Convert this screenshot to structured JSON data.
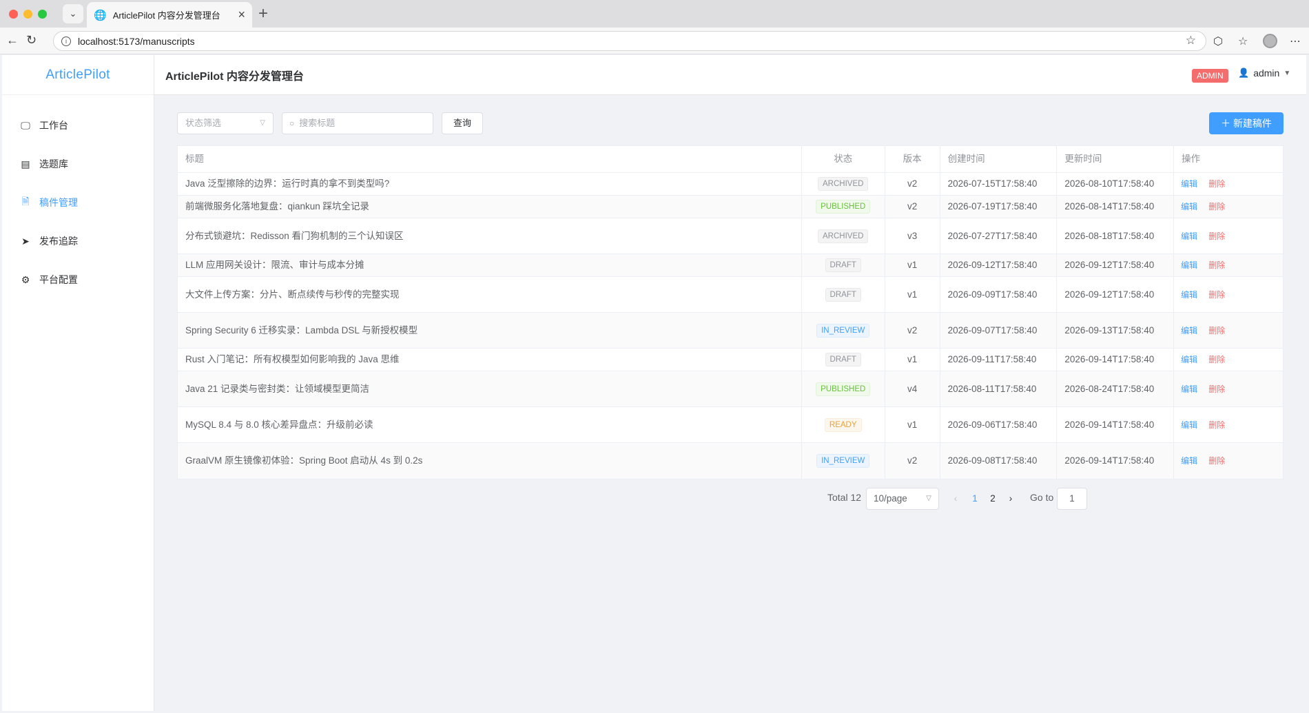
{
  "browser": {
    "tab_title": "ArticlePilot 内容分发管理台",
    "url": "localhost:5173/manuscripts",
    "new_tab": "+"
  },
  "app": {
    "logo": "ArticlePilot",
    "header_title": "ArticlePilot 内容分发管理台",
    "role_badge": "ADMIN",
    "username": "admin"
  },
  "sidebar": {
    "items": [
      {
        "label": "工作台",
        "icon": "monitor-icon",
        "active": false
      },
      {
        "label": "选题库",
        "icon": "book-icon",
        "active": false
      },
      {
        "label": "稿件管理",
        "icon": "document-icon",
        "active": true
      },
      {
        "label": "发布追踪",
        "icon": "paper-plane-icon",
        "active": false
      },
      {
        "label": "平台配置",
        "icon": "gear-icon",
        "active": false
      }
    ]
  },
  "toolbar": {
    "status_placeholder": "状态筛选",
    "search_placeholder": "搜索标题",
    "query_label": "查询",
    "new_label": "新建稿件"
  },
  "table": {
    "headers": [
      "标题",
      "状态",
      "版本",
      "创建时间",
      "更新时间",
      "操作"
    ],
    "rows": [
      {
        "title": "Java 泛型擦除的边界：运行时真的拿不到类型吗?",
        "status": "ARCHIVED",
        "version": "v2",
        "created": "2026-07-15T17:58:40",
        "updated": "2026-08-10T17:58:40"
      },
      {
        "title": "前端微服务化落地复盘：qiankun 踩坑全记录",
        "status": "PUBLISHED",
        "version": "v2",
        "created": "2026-07-19T17:58:40",
        "updated": "2026-08-14T17:58:40"
      },
      {
        "title": "分布式锁避坑：Redisson 看门狗机制的三个认知误区",
        "status": "ARCHIVED",
        "version": "v3",
        "created": "2026-07-27T17:58:40",
        "updated": "2026-08-18T17:58:40"
      },
      {
        "title": "LLM 应用网关设计：限流、审计与成本分摊",
        "status": "DRAFT",
        "version": "v1",
        "created": "2026-09-12T17:58:40",
        "updated": "2026-09-12T17:58:40"
      },
      {
        "title": "大文件上传方案：分片、断点续传与秒传的完整实现",
        "status": "DRAFT",
        "version": "v1",
        "created": "2026-09-09T17:58:40",
        "updated": "2026-09-12T17:58:40"
      },
      {
        "title": "Spring Security 6 迁移实录：Lambda DSL 与新授权模型",
        "status": "IN_REVIEW",
        "version": "v2",
        "created": "2026-09-07T17:58:40",
        "updated": "2026-09-13T17:58:40"
      },
      {
        "title": "Rust 入门笔记：所有权模型如何影响我的 Java 思维",
        "status": "DRAFT",
        "version": "v1",
        "created": "2026-09-11T17:58:40",
        "updated": "2026-09-14T17:58:40"
      },
      {
        "title": "Java 21 记录类与密封类：让领域模型更简洁",
        "status": "PUBLISHED",
        "version": "v4",
        "created": "2026-08-11T17:58:40",
        "updated": "2026-08-24T17:58:40"
      },
      {
        "title": "MySQL 8.4 与 8.0 核心差异盘点：升级前必读",
        "status": "READY",
        "version": "v1",
        "created": "2026-09-06T17:58:40",
        "updated": "2026-09-14T17:58:40"
      },
      {
        "title": "GraalVM 原生镜像初体验：Spring Boot 启动从 4s 到 0.2s",
        "status": "IN_REVIEW",
        "version": "v2",
        "created": "2026-09-08T17:58:40",
        "updated": "2026-09-14T17:58:40"
      }
    ],
    "edit_label": "编辑",
    "delete_label": "删除"
  },
  "pagination": {
    "total": "Total 12",
    "page_size": "10/page",
    "pages": [
      "1",
      "2"
    ],
    "current": "1",
    "goto_label": "Go to",
    "goto_value": "1"
  }
}
